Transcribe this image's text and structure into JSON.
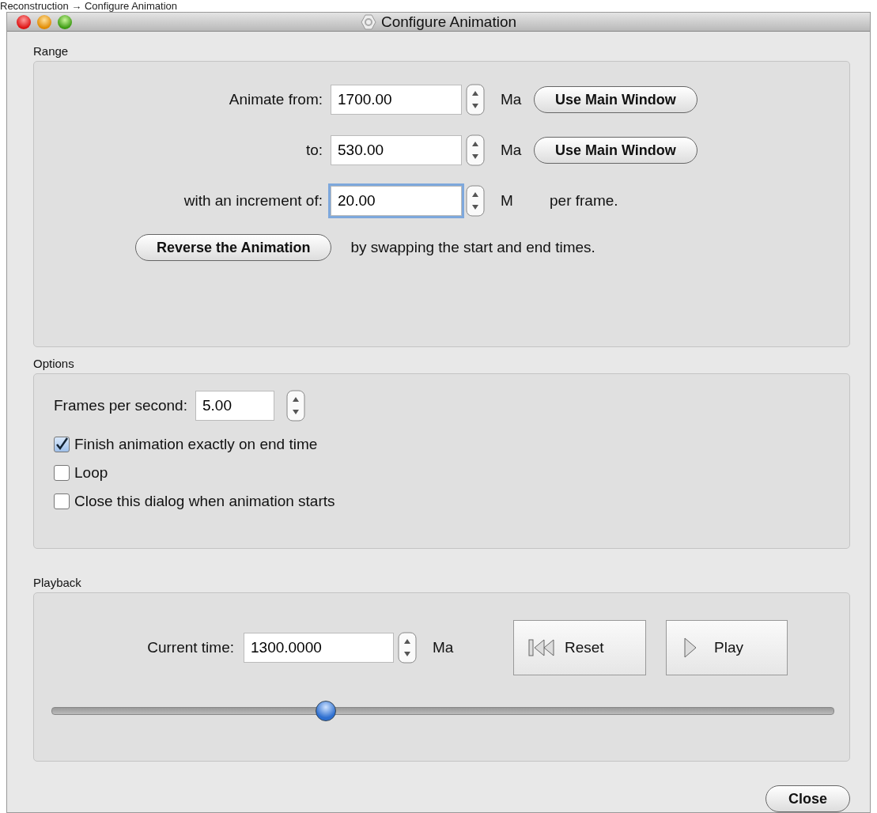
{
  "breadcrumb": "Reconstruction → Configure Animation",
  "window": {
    "title": "Configure Animation"
  },
  "range": {
    "title": "Range",
    "rows": [
      {
        "label": "Animate from:",
        "value": "1700.00",
        "focused": false,
        "unit": "Ma",
        "button": "Use Main Window"
      },
      {
        "label": "to:",
        "value": "530.00",
        "focused": false,
        "unit": "Ma",
        "button": "Use Main Window"
      },
      {
        "label": "with an increment of:",
        "value": "20.00",
        "focused": true,
        "unit": "M",
        "suffix": "per frame."
      }
    ],
    "reverse_button": "Reverse the Animation",
    "reverse_note": "by swapping the start and end times."
  },
  "options": {
    "title": "Options",
    "fps_label": "Frames per second:",
    "fps_value": "5.00",
    "checkboxes": [
      {
        "label": "Finish animation exactly on end time",
        "checked": true
      },
      {
        "label": "Loop",
        "checked": false
      },
      {
        "label": "Close this dialog when animation starts",
        "checked": false
      }
    ]
  },
  "playback": {
    "title": "Playback",
    "time_label": "Current time:",
    "time_value": "1300.0000",
    "unit": "Ma",
    "buttons": [
      {
        "kind": "reset",
        "label": "Reset"
      },
      {
        "kind": "play",
        "label": "Play"
      }
    ],
    "slider": {
      "level": 0.35
    }
  },
  "close_button": "Close"
}
